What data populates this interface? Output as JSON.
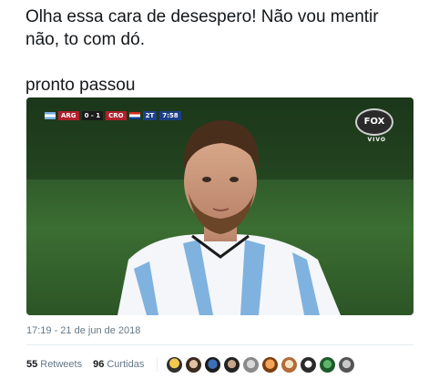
{
  "tweet": {
    "line1": "Olha essa cara de desespero! Não vou mentir",
    "line2": "não, to com dó.",
    "line3": "pronto passou"
  },
  "media": {
    "scorebug": {
      "team1": "ARG",
      "score": "0 - 1",
      "team2": "CRO",
      "period": "2T",
      "clock": "7:58"
    },
    "broadcaster": "FOX",
    "live_label": "VIVO"
  },
  "timestamp": "17:19 - 21 de jun de 2018",
  "stats": {
    "retweets_count": "55",
    "retweets_label": "Retweets",
    "likes_count": "96",
    "likes_label": "Curtidas"
  },
  "colors": {
    "text": "#14171a",
    "muted": "#657786",
    "divider": "#e6ecf0"
  },
  "avatars": [
    "avatar-1",
    "avatar-2",
    "avatar-3",
    "avatar-4",
    "avatar-5",
    "avatar-6",
    "avatar-7",
    "avatar-8",
    "avatar-9",
    "avatar-10"
  ]
}
